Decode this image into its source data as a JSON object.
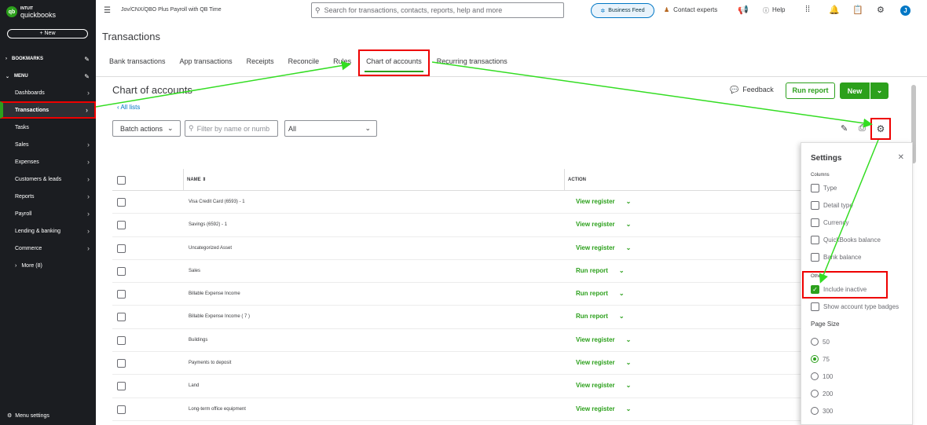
{
  "sidebar": {
    "logo_line1": "INTUIT",
    "logo_line2": "quickbooks",
    "new_label": "+ New",
    "bookmarks": "BOOKMARKS",
    "menu": "MENU",
    "items": [
      {
        "label": "Dashboards"
      },
      {
        "label": "Transactions"
      },
      {
        "label": "Tasks"
      },
      {
        "label": "Sales"
      },
      {
        "label": "Expenses"
      },
      {
        "label": "Customers & leads"
      },
      {
        "label": "Reports"
      },
      {
        "label": "Payroll"
      },
      {
        "label": "Lending & banking"
      },
      {
        "label": "Commerce"
      },
      {
        "label": "More (8)"
      }
    ],
    "menu_settings": "Menu settings"
  },
  "topbar": {
    "company": "Jov/CNX/QBO Plus Payroll with QB Time",
    "search_placeholder": "Search for transactions, contacts, reports, help and more",
    "business_feed": "Business Feed",
    "contact_experts": "Contact experts",
    "help": "Help",
    "avatar_initial": "J"
  },
  "page": {
    "title": "Transactions",
    "tabs": [
      "Bank transactions",
      "App transactions",
      "Receipts",
      "Reconcile",
      "Rules",
      "Chart of accounts",
      "Recurring transactions"
    ]
  },
  "main": {
    "title": "Chart of accounts",
    "all_lists": "All lists",
    "batch_actions": "Batch actions",
    "filter_placeholder": "Filter by name or numb",
    "filter_select": "All",
    "feedback": "Feedback",
    "run_report": "Run report",
    "new": "New"
  },
  "table": {
    "col_name": "NAME",
    "col_action": "ACTION",
    "rows": [
      {
        "name": "Visa Credit Card (6593) - 1",
        "action": "View register"
      },
      {
        "name": "Savings (6592) - 1",
        "action": "View register"
      },
      {
        "name": "Uncategorized Asset",
        "action": "View register"
      },
      {
        "name": "Sales",
        "action": "Run report"
      },
      {
        "name": "Billable Expense Income",
        "action": "Run report"
      },
      {
        "name": "Billable Expense Income ( 7 )",
        "action": "Run report"
      },
      {
        "name": "Buildings",
        "action": "View register"
      },
      {
        "name": "Payments to deposit",
        "action": "View register"
      },
      {
        "name": "Land",
        "action": "View register"
      },
      {
        "name": "Long-term office equipment",
        "action": "View register"
      }
    ]
  },
  "settings": {
    "title": "Settings",
    "columns_label": "Columns",
    "columns": [
      "Type",
      "Detail type",
      "Currency",
      "QuickBooks balance",
      "Bank balance"
    ],
    "other_label": "Other",
    "include_inactive": "Include inactive",
    "show_badges": "Show account type badges",
    "page_size_label": "Page Size",
    "page_sizes": [
      "50",
      "75",
      "100",
      "200",
      "300"
    ],
    "selected_page_size": "75"
  },
  "colors": {
    "brand": "#2ca01c",
    "highlight": "#e00000",
    "arrow": "#33dd22"
  }
}
